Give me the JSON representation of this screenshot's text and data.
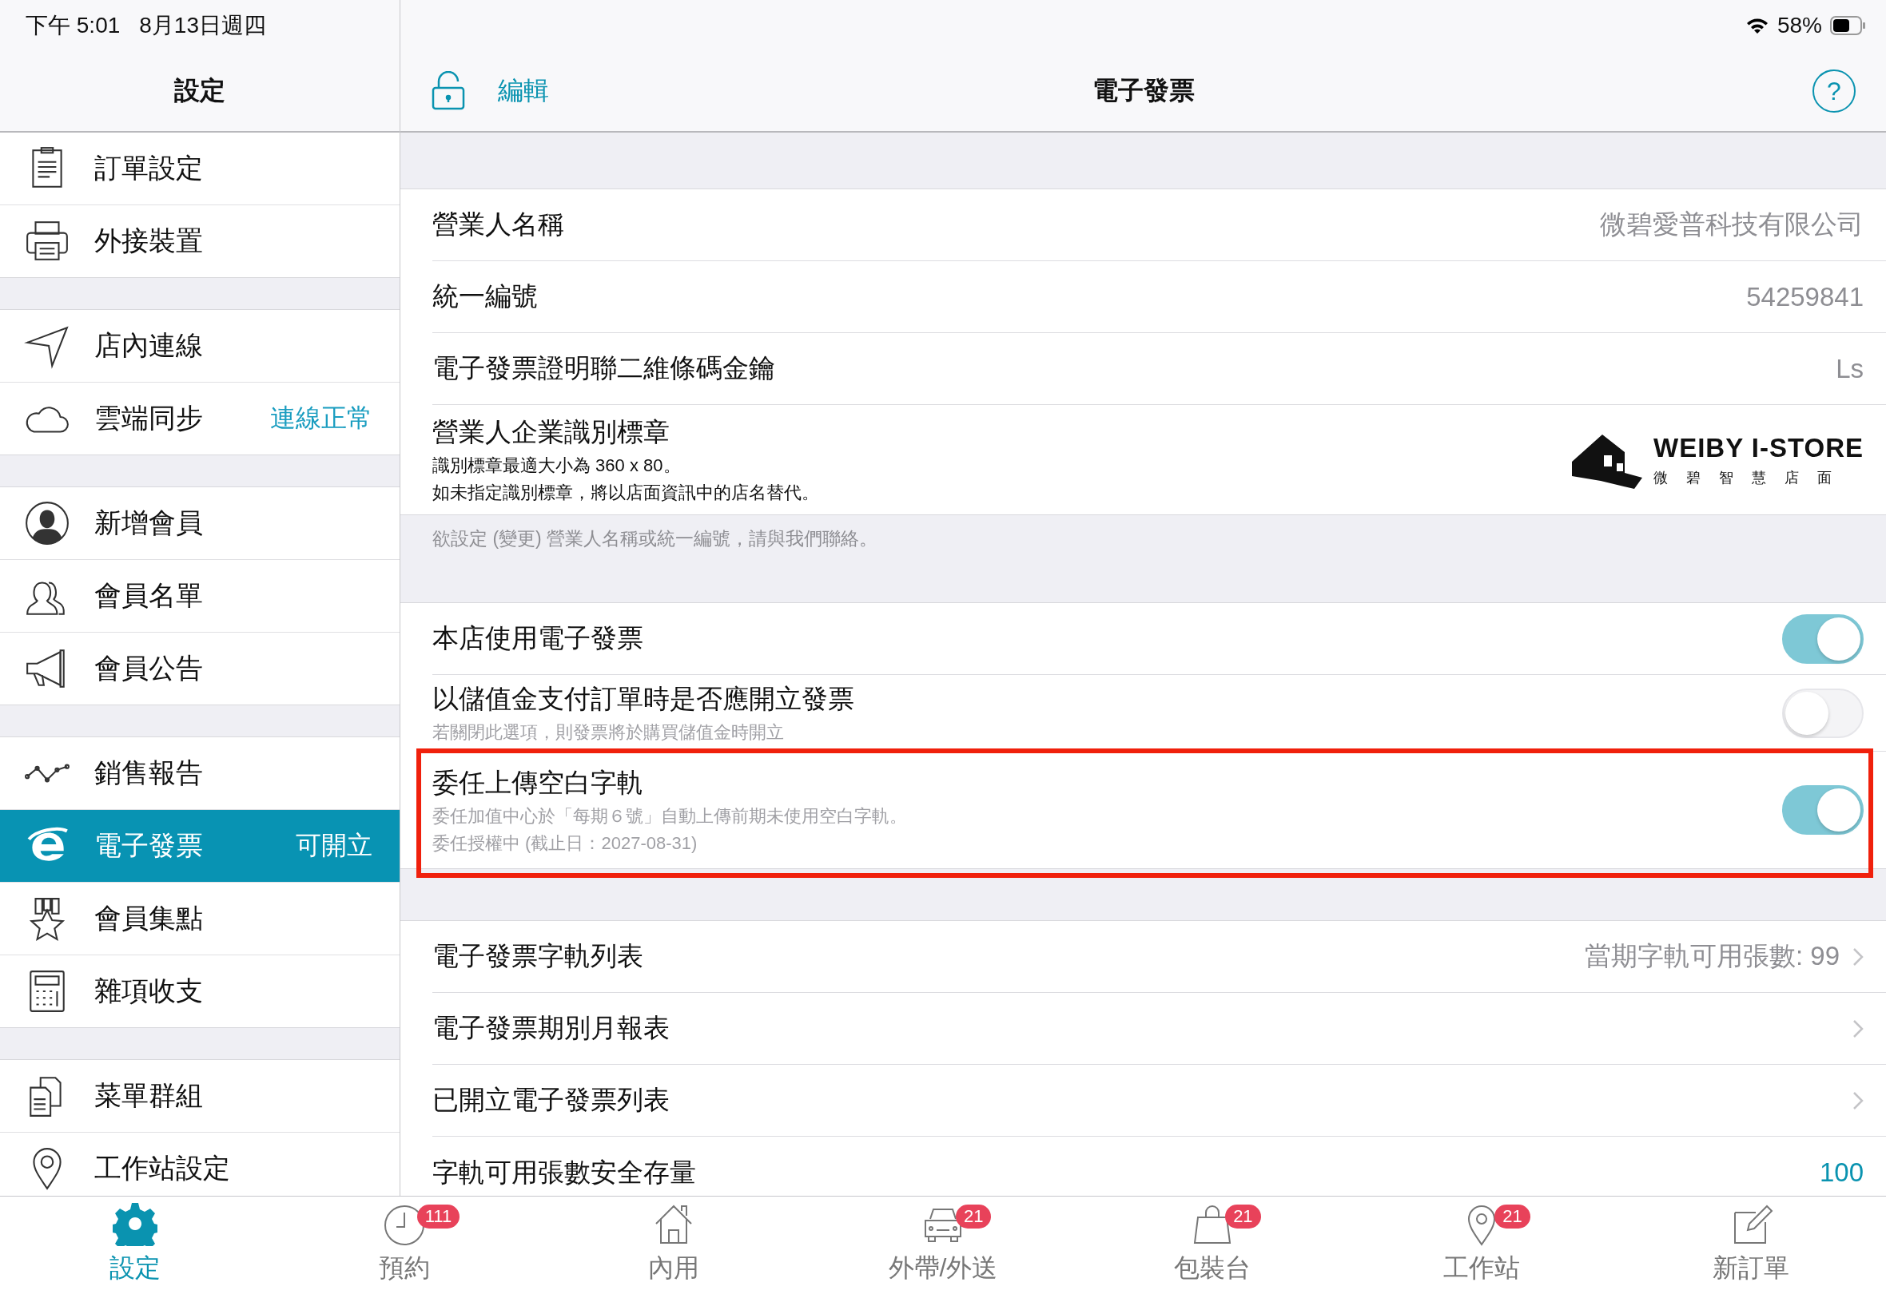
{
  "status_bar": {
    "time": "下午 5:01",
    "date": "8月13日週四",
    "battery": "58%"
  },
  "sidebar": {
    "title": "設定",
    "groups": [
      {
        "items": [
          {
            "label": "訂單設定",
            "selected": false
          },
          {
            "label": "外接裝置",
            "selected": false
          }
        ]
      },
      {
        "items": [
          {
            "label": "店內連線",
            "selected": false
          },
          {
            "label": "雲端同步",
            "status": "連線正常",
            "selected": false
          }
        ]
      },
      {
        "items": [
          {
            "label": "新增會員",
            "selected": false
          },
          {
            "label": "會員名單",
            "selected": false
          },
          {
            "label": "會員公告",
            "selected": false
          }
        ]
      },
      {
        "items": [
          {
            "label": "銷售報告",
            "selected": false
          },
          {
            "label": "電子發票",
            "status": "可開立",
            "selected": true
          },
          {
            "label": "會員集點",
            "selected": false
          },
          {
            "label": "雜項收支",
            "selected": false
          }
        ]
      },
      {
        "items": [
          {
            "label": "菜單群組",
            "selected": false
          },
          {
            "label": "工作站設定",
            "selected": false
          }
        ]
      }
    ]
  },
  "header": {
    "edit": "編輯",
    "title": "電子發票",
    "help": "?"
  },
  "sections": [
    {
      "rows": [
        {
          "kind": "value",
          "label": "營業人名稱",
          "value": "微碧愛普科技有限公司"
        },
        {
          "kind": "value",
          "label": "統一編號",
          "value": "54259841"
        },
        {
          "kind": "value",
          "label": "電子發票證明聯二維條碼金鑰",
          "value": "Ls"
        },
        {
          "kind": "logo",
          "label": "營業人企業識別標章",
          "notes": [
            "識別標章最適大小為 360 x 80。",
            "如未指定識別標章，將以店面資訊中的店名替代。"
          ],
          "logo": {
            "title": "WEIBY I-STORE",
            "subtitle": "微碧智慧店面"
          }
        }
      ],
      "footer": "欲設定 (變更) 營業人名稱或統一編號，請與我們聯絡。"
    },
    {
      "rows": [
        {
          "kind": "toggle",
          "label": "本店使用電子發票",
          "on": true,
          "highlighted": false
        },
        {
          "kind": "toggle",
          "label": "以儲值金支付訂單時是否應開立發票",
          "notes": [
            "若關閉此選項，則發票將於購買儲值金時開立"
          ],
          "on": false,
          "highlighted": false
        },
        {
          "kind": "toggle",
          "label": "委任上傳空白字軌",
          "notes": [
            "委任加值中心於「每期６號」自動上傳前期未使用空白字軌。",
            "委任授權中 (截止日：2027-08-31)"
          ],
          "on": true,
          "highlighted": true
        }
      ]
    },
    {
      "rows": [
        {
          "kind": "nav",
          "label": "電子發票字軌列表",
          "value": "當期字軌可用張數: 99"
        },
        {
          "kind": "nav",
          "label": "電子發票期別月報表"
        },
        {
          "kind": "nav",
          "label": "已開立電子發票列表"
        },
        {
          "kind": "value",
          "label": "字軌可用張數安全存量",
          "value": "100",
          "accent": true
        }
      ]
    }
  ],
  "tab_bar": [
    {
      "label": "設定",
      "selected": true
    },
    {
      "label": "預約",
      "badge": "111",
      "selected": false
    },
    {
      "label": "內用",
      "selected": false
    },
    {
      "label": "外帶/外送",
      "badge": "21",
      "selected": false
    },
    {
      "label": "包裝台",
      "badge": "21",
      "selected": false
    },
    {
      "label": "工作站",
      "badge": "21",
      "selected": false
    },
    {
      "label": "新訂單",
      "selected": false
    }
  ]
}
